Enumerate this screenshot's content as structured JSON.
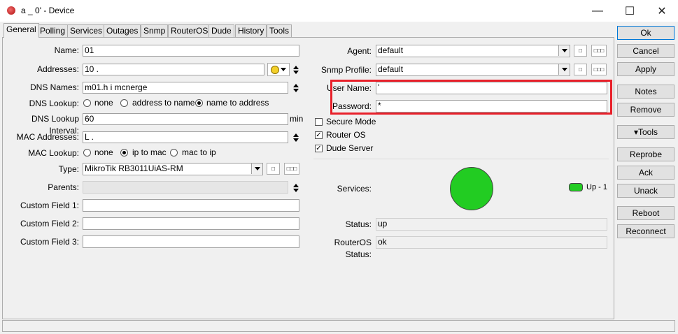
{
  "window": {
    "title": "a          _   0' - Device"
  },
  "tabs": [
    "General",
    "Polling",
    "Services",
    "Outages",
    "Snmp",
    "RouterOS",
    "Dude",
    "History",
    "Tools"
  ],
  "general": {
    "name_label": "Name:",
    "name_value": "           01",
    "addresses_label": "Addresses:",
    "addresses_value": "10      .    ",
    "dns_names_label": "DNS Names:",
    "dns_names_value": "          m01.h    i      mcnerge",
    "dns_lookup_label": "DNS Lookup:",
    "dns_lookup_options": [
      "none",
      "address to name",
      "name to address"
    ],
    "dns_lookup_interval_label": "DNS Lookup Interval:",
    "dns_lookup_interval_value": "60",
    "dns_lookup_interval_unit": "min",
    "mac_addresses_label": "MAC Addresses:",
    "mac_addresses_value": "L         .",
    "mac_lookup_label": "MAC Lookup:",
    "mac_lookup_options": [
      "none",
      "ip to mac",
      "mac to ip"
    ],
    "type_label": "Type:",
    "type_value": "MikroTik RB3011UiAS-RM",
    "parents_label": "Parents:",
    "custom1_label": "Custom Field 1:",
    "custom2_label": "Custom Field 2:",
    "custom3_label": "Custom Field 3:",
    "agent_label": "Agent:",
    "agent_value": "default",
    "snmp_profile_label": "Snmp Profile:",
    "snmp_profile_value": "default",
    "username_label": "User Name:",
    "username_value": "'",
    "password_label": "Password:",
    "password_value": "*",
    "secure_mode_label": "Secure Mode",
    "router_os_label": "Router OS",
    "dude_server_label": "Dude Server",
    "services_label": "Services:",
    "services_legend": "Up - 1",
    "status_label": "Status:",
    "status_value": "up",
    "routeros_status_label": "RouterOS Status:",
    "routeros_status_value": "ok",
    "small_btn_label": "□",
    "dots_btn_label": "□□□",
    "check_mark": "✓"
  },
  "buttons": {
    "ok": "Ok",
    "cancel": "Cancel",
    "apply": "Apply",
    "notes": "Notes",
    "remove": "Remove",
    "tools": "▾Tools",
    "reprobe": "Reprobe",
    "ack": "Ack",
    "unack": "Unack",
    "reboot": "Reboot",
    "reconnect": "Reconnect"
  },
  "icons": {
    "minimize": "—",
    "maximize": "☐",
    "close": "✕"
  },
  "colors": {
    "highlight": "#e8202a",
    "service_up": "#22cc22"
  }
}
